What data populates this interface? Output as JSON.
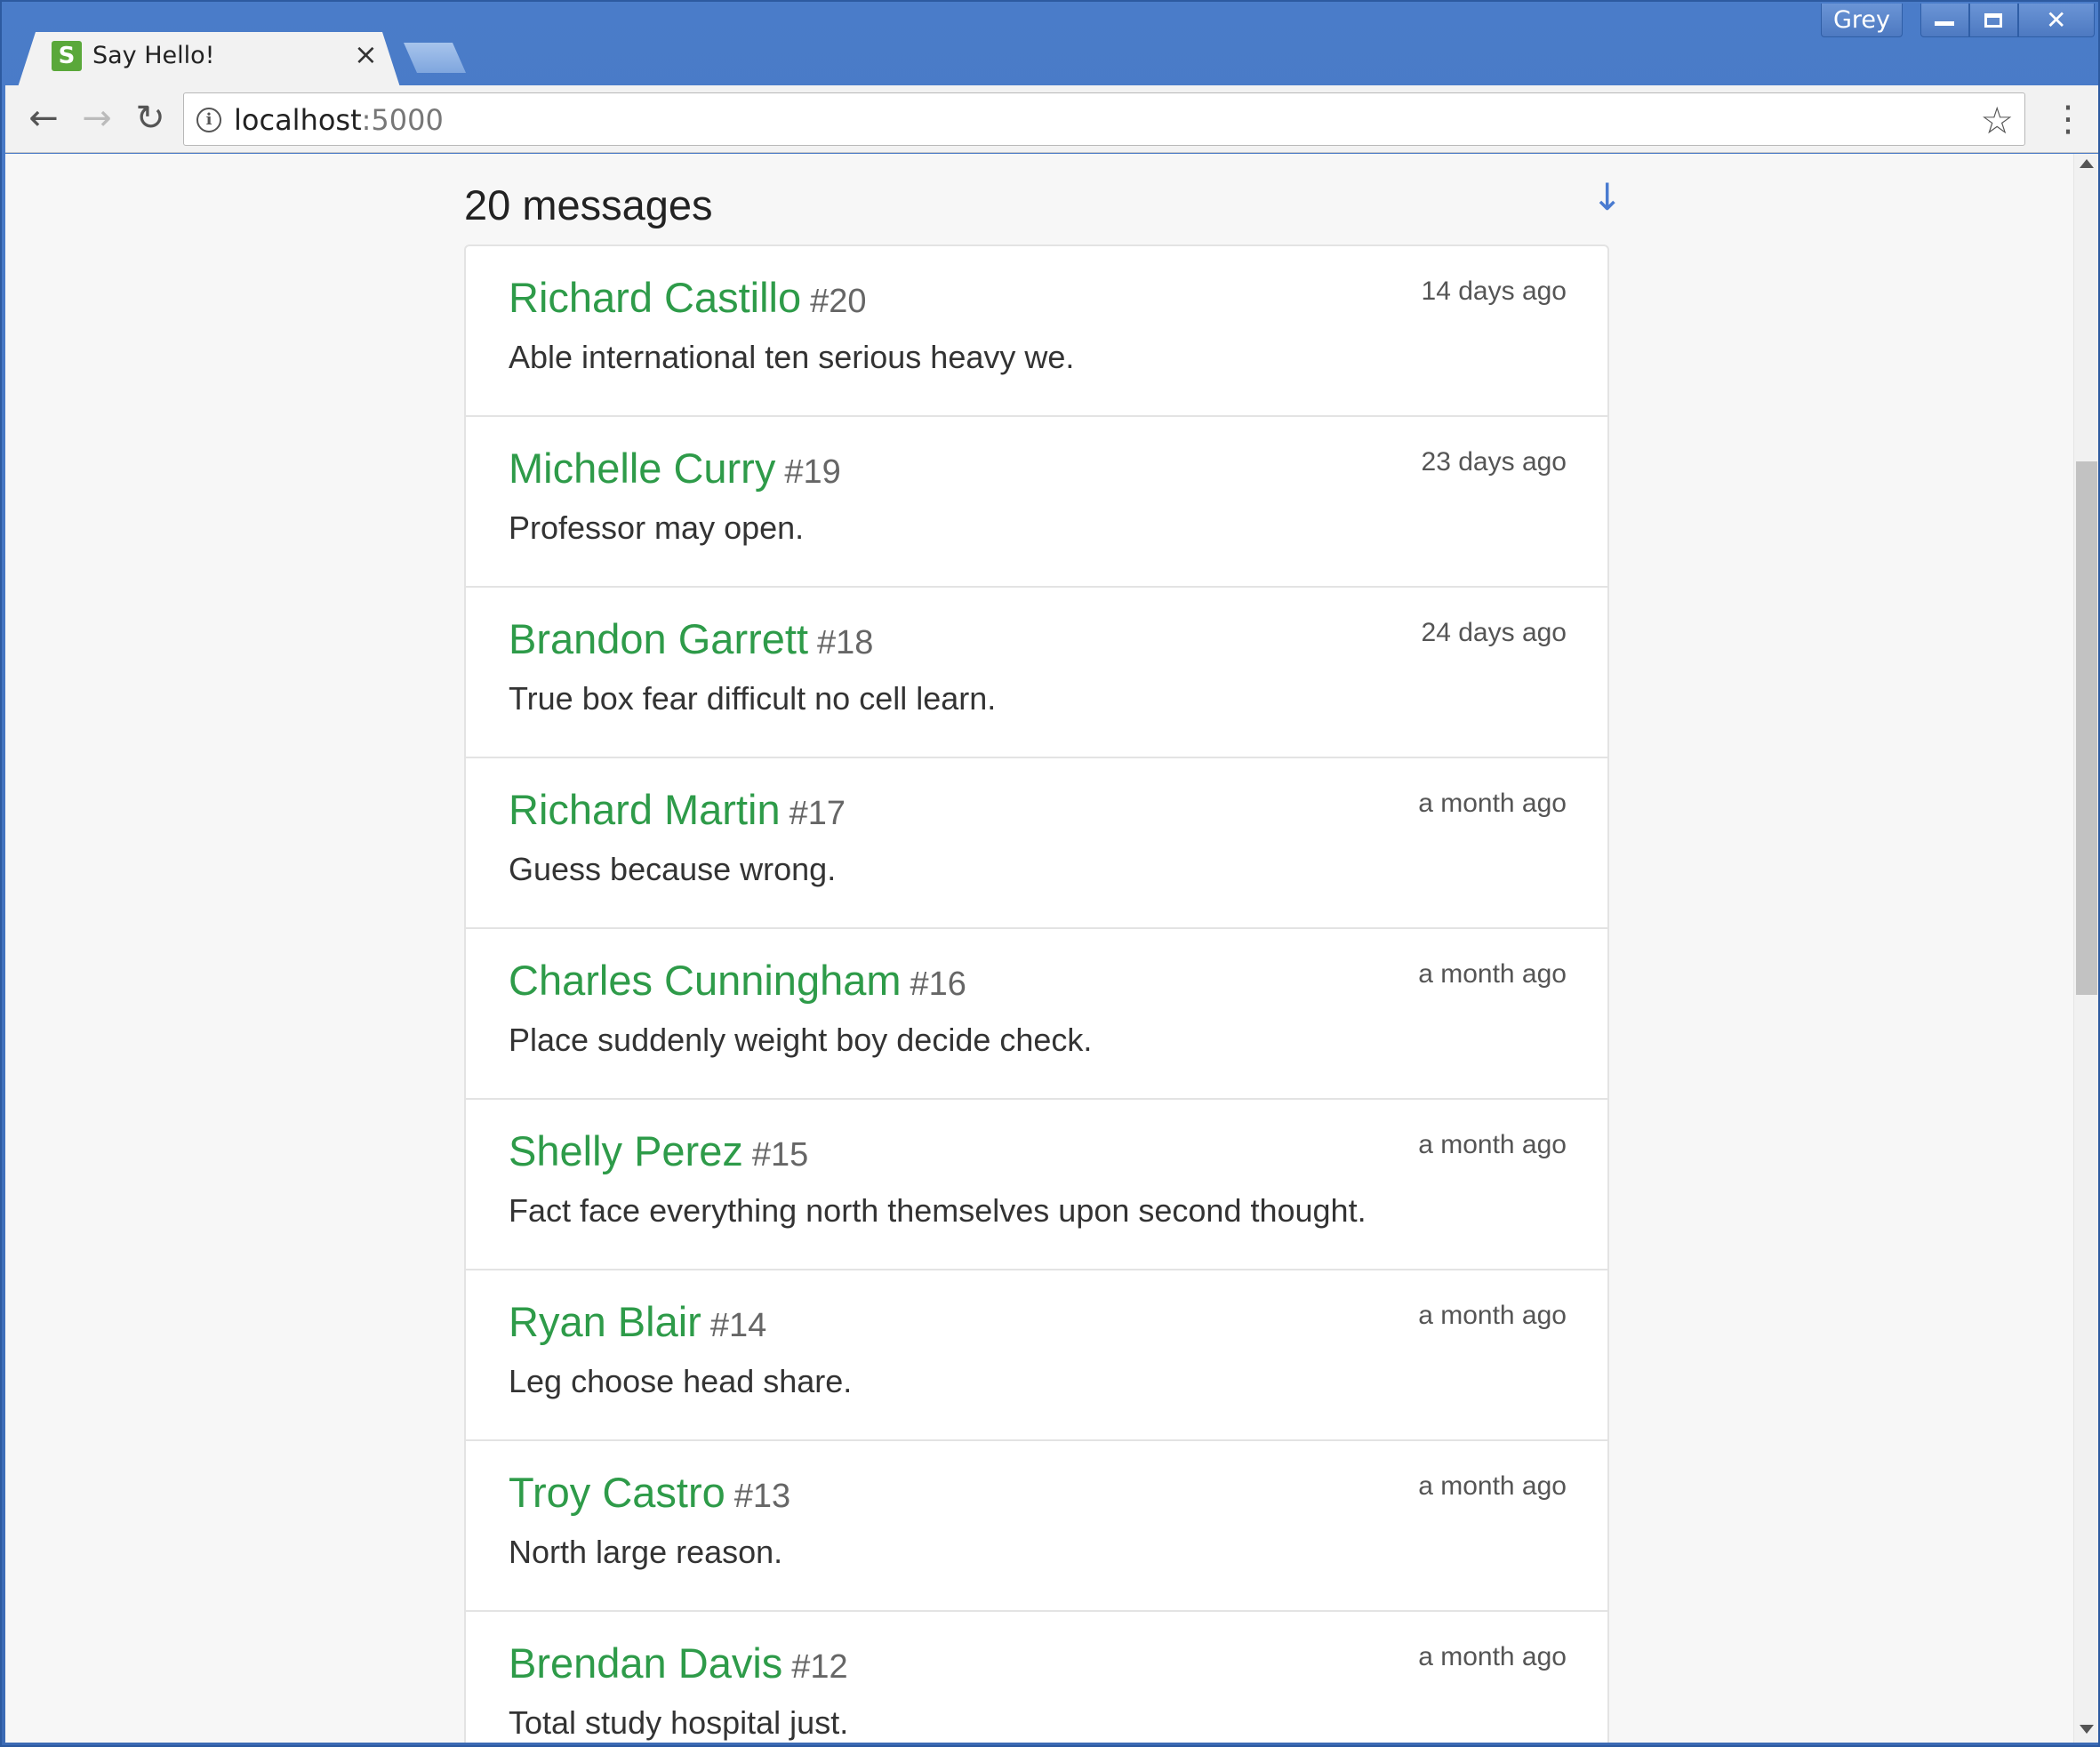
{
  "window": {
    "profile_label": "Grey",
    "minimize_icon": "minimize-icon",
    "maximize_icon": "maximize-icon",
    "close_glyph": "✕"
  },
  "tab": {
    "favicon_letter": "S",
    "title": "Say Hello!",
    "close_glyph": "×"
  },
  "toolbar": {
    "back_glyph": "←",
    "forward_glyph": "→",
    "reload_glyph": "↻",
    "url_host": "localhost",
    "url_port": ":5000",
    "info_glyph": "i",
    "star_glyph": "☆",
    "menu_glyph": "⋮"
  },
  "page": {
    "count_heading": "20 messages",
    "scroll_down_glyph": "↓",
    "messages": [
      {
        "name": "Richard Castillo",
        "number": "#20",
        "time": "14 days ago",
        "body": "Able international ten serious heavy we."
      },
      {
        "name": "Michelle Curry",
        "number": "#19",
        "time": "23 days ago",
        "body": "Professor may open."
      },
      {
        "name": "Brandon Garrett",
        "number": "#18",
        "time": "24 days ago",
        "body": "True box fear difficult no cell learn."
      },
      {
        "name": "Richard Martin",
        "number": "#17",
        "time": "a month ago",
        "body": "Guess because wrong."
      },
      {
        "name": "Charles Cunningham",
        "number": "#16",
        "time": "a month ago",
        "body": "Place suddenly weight boy decide check."
      },
      {
        "name": "Shelly Perez",
        "number": "#15",
        "time": "a month ago",
        "body": "Fact face everything north themselves upon second thought."
      },
      {
        "name": "Ryan Blair",
        "number": "#14",
        "time": "a month ago",
        "body": "Leg choose head share."
      },
      {
        "name": "Troy Castro",
        "number": "#13",
        "time": "a month ago",
        "body": "North large reason."
      },
      {
        "name": "Brendan Davis",
        "number": "#12",
        "time": "a month ago",
        "body": "Total study hospital just."
      }
    ]
  },
  "colors": {
    "name_green": "#2e9b49",
    "chrome_blue": "#3b6cb7",
    "link_blue": "#4a7bd0"
  }
}
